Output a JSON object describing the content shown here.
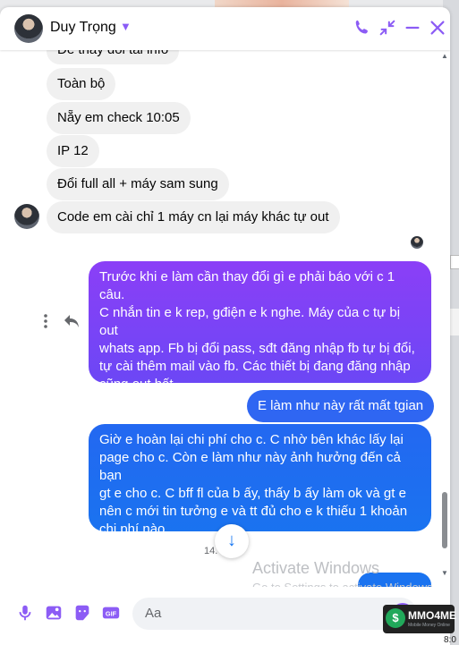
{
  "header": {
    "name": "Duy Trọng",
    "chevron": "chevron-down-icon",
    "icons": [
      "phone-icon",
      "minimize-arrows-icon",
      "minimize-icon",
      "close-icon"
    ]
  },
  "colors": {
    "accent": "#8c5cf5",
    "incoming_bg": "#f0f0f0",
    "outgoing_top": "#8b3ff7",
    "outgoing_bottom": "#1a73f0"
  },
  "messages": [
    {
      "text": "Để thay đổi tài info",
      "dir": "in"
    },
    {
      "text": "Toàn bộ",
      "dir": "in"
    },
    {
      "text": "Nẵy em check 10:05",
      "dir": "in"
    },
    {
      "text": "IP 12",
      "dir": "in"
    },
    {
      "text": "Đổi full all + máy sam sung",
      "dir": "in"
    },
    {
      "text": "Code em cài chỉ 1 máy cn lại máy khác tự out",
      "dir": "in"
    },
    {
      "text": "Trước khi e làm cần thay đổi gì e phải báo với c 1 câu.\nC nhắn tin e k rep, gđiện e k nghe. Máy của c tự bị out\nwhats app. Fb bị đổi pass, sđt đăng nhập fb tự bị đổi,\ntự cài thêm mail vào fb. Các  thiết bị đang đăng nhập\ncũng out hết.\nC còn hỏi e đang làm gì fb của c e cũng k rep",
      "dir": "out"
    },
    {
      "text": "E làm như này rất mất tgian",
      "dir": "out"
    },
    {
      "text": "Giờ e hoàn lại chi phí cho c. C nhờ bên khác lấy lại\npage cho c. Còn e làm như này ảnh hưởng đến cả bạn\ngt e cho c. C bff fl của b ấy, thấy b ấy làm ok và gt e\nnên c mới tin tưởng e và tt đủ cho e k thiếu 1 khoản\nchi phí nào.",
      "dir": "out"
    }
  ],
  "timestamp": "14.",
  "composer": {
    "placeholder": "Aa"
  },
  "footer_icons": [
    "microphone-icon",
    "image-icon",
    "sticker-icon",
    "gif-icon",
    "emoji-icon",
    "thumbs-up-icon"
  ],
  "watermark": {
    "line1": "Activate Windows",
    "line2": "Go to Settings to activate Windows."
  },
  "badge": {
    "text": "MMO4ME",
    "sub": "Mobile Money Online"
  },
  "clock": "8:0"
}
